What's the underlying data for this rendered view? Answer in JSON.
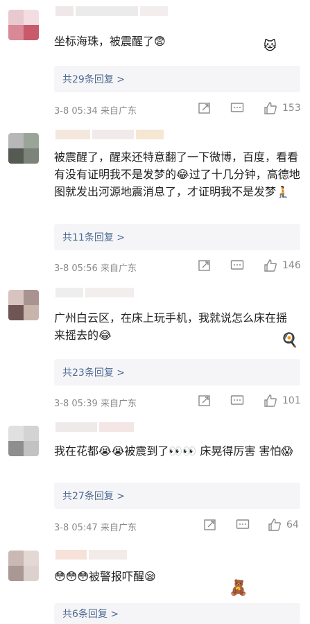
{
  "comments": [
    {
      "text": "坐标海珠，被震醒了😨",
      "replies": "共29条回复 >",
      "meta": "3-8 05:34 来自广东",
      "likes": "153"
    },
    {
      "text": "被震醒了，醒来还特意翻了一下微博，百度，看看有没有证明我不是发梦的😂过了十几分钟，高德地图就发出河源地震消息了，才证明我不是发梦🧎",
      "replies": "共11条回复 >",
      "meta": "3-8 05:56 来自广东",
      "likes": "146"
    },
    {
      "text": "广州白云区，在床上玩手机，我就说怎么床在摇来摇去的😂",
      "replies": "共23条回复 >",
      "meta": "3-8 05:39 来自广东",
      "likes": "101"
    },
    {
      "text": "我在花都😭😭被震到了👀👀 床晃得厉害 害怕😱",
      "replies": "共27条回复 >",
      "meta": "3-8 05:47 来自广东",
      "likes": "64"
    },
    {
      "text": "😳😳😳被警报吓醒😪",
      "replies": "共6条回复 >",
      "meta": "",
      "likes": ""
    }
  ],
  "icons": {
    "share": "share-icon",
    "comment": "comment-icon",
    "like": "thumbs-up-icon"
  },
  "colors": {
    "link": "#4e6a93",
    "meta": "#8a8a8a",
    "reply_bg": "#f5f5f7"
  }
}
